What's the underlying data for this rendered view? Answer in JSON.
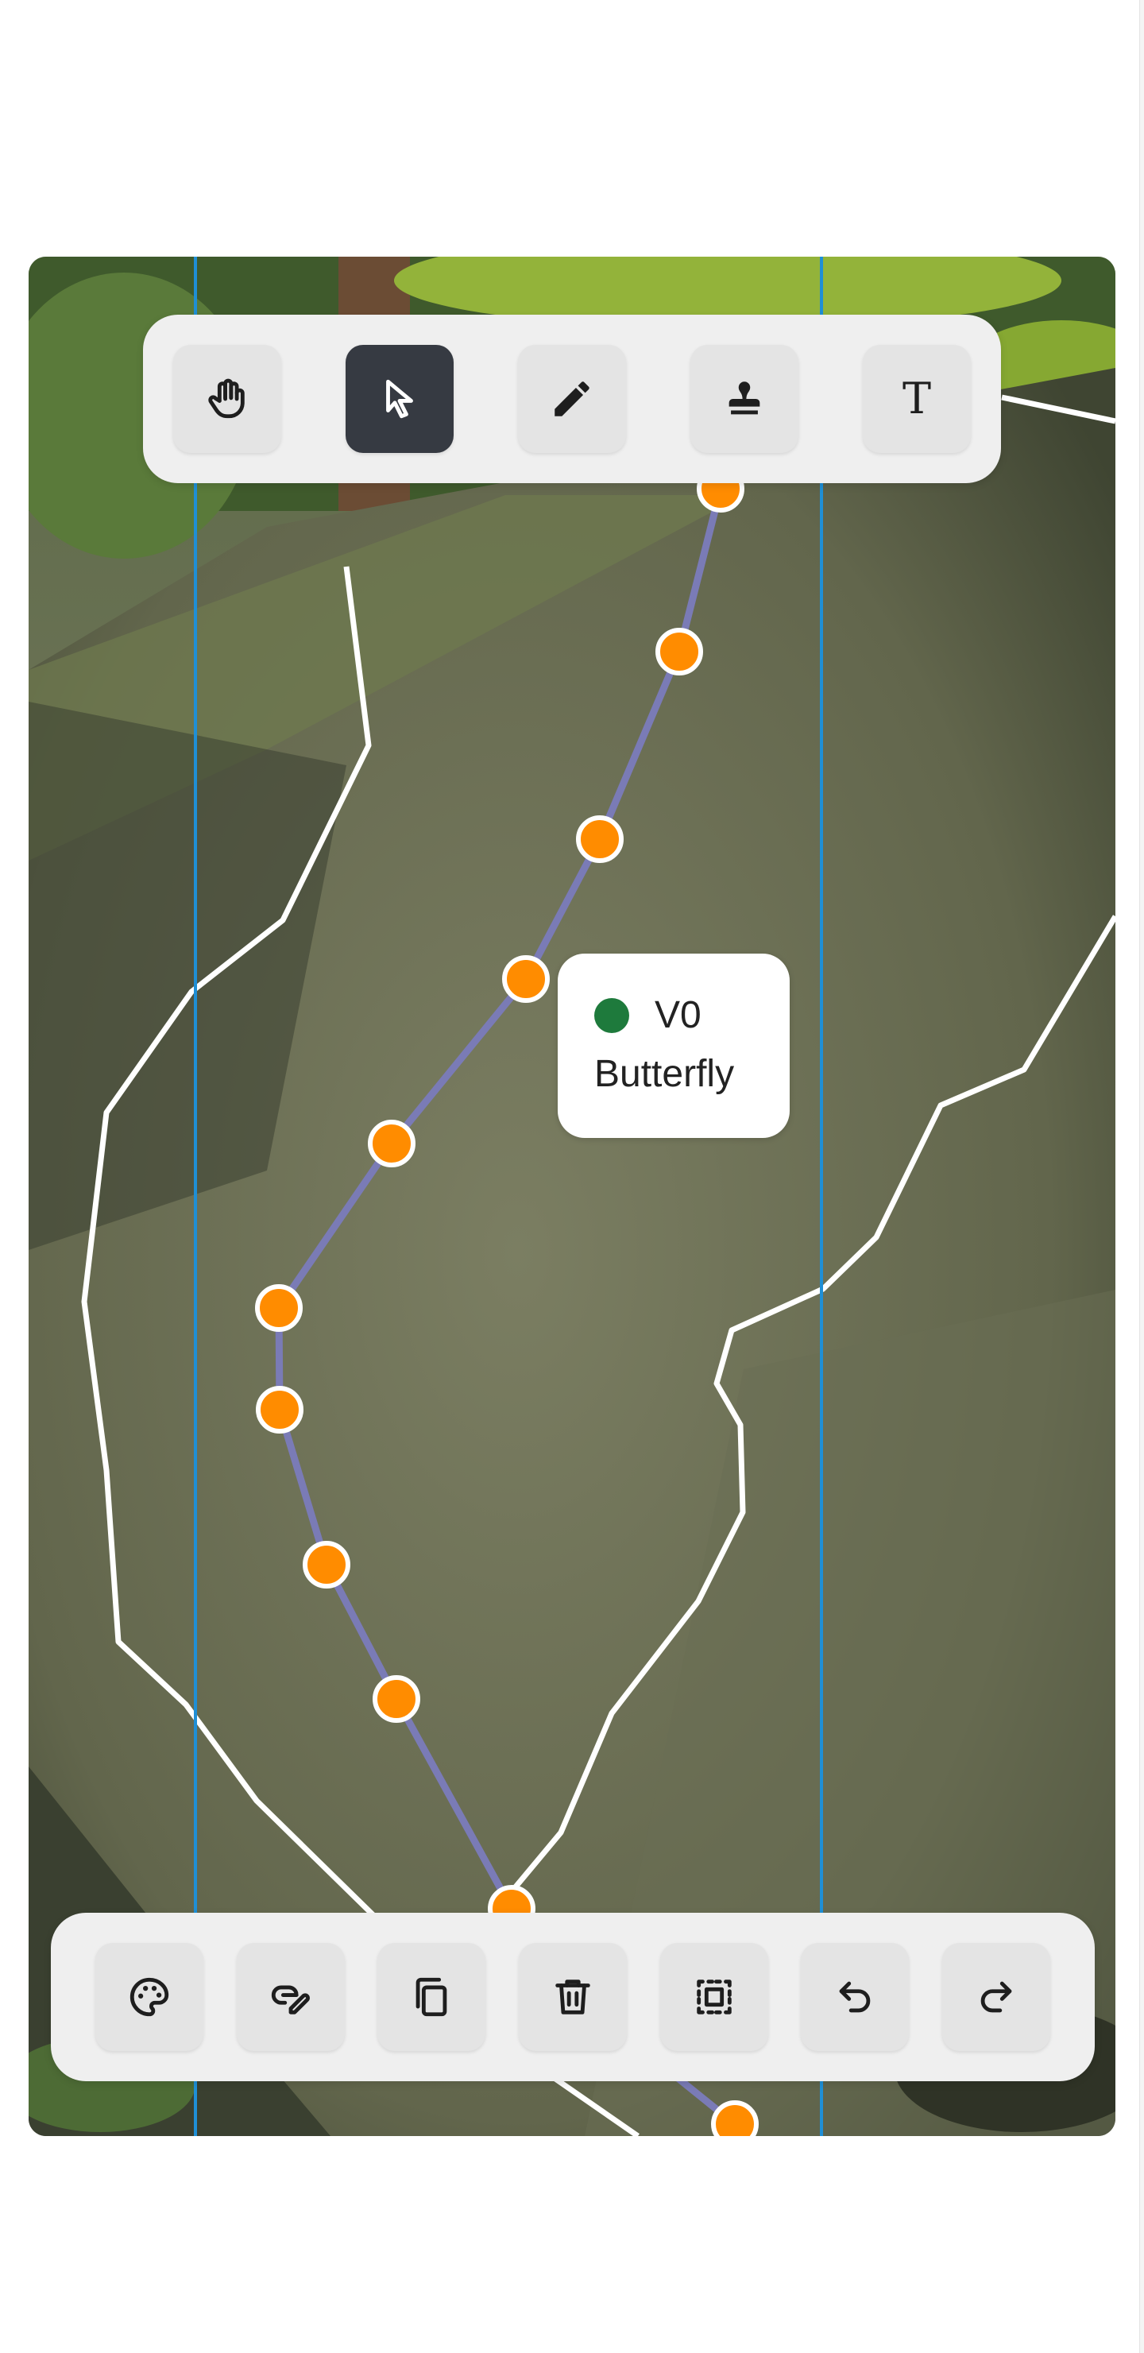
{
  "route_label": {
    "grade": "V0",
    "name": "Butterfly",
    "grade_color": "#1e7a3c"
  },
  "colors": {
    "route_line": "#7a7bb6",
    "hold_fill": "#ff8c00",
    "hold_stroke": "#ffffff",
    "boulder_outline": "#ffffff",
    "guide_line": "#1f8fd6",
    "active_tool_bg": "#363a42"
  },
  "top_toolbar": [
    {
      "name": "pan",
      "icon": "hand-icon",
      "active": false
    },
    {
      "name": "select",
      "icon": "cursor-arrow-icon",
      "active": true
    },
    {
      "name": "draw",
      "icon": "pencil-icon",
      "active": false
    },
    {
      "name": "stamp",
      "icon": "stamp-icon",
      "active": false
    },
    {
      "name": "text",
      "icon": "text-icon",
      "glyph": "T",
      "active": false
    }
  ],
  "bottom_toolbar": [
    {
      "name": "color",
      "icon": "palette-icon"
    },
    {
      "name": "edit-link",
      "icon": "link-edit-icon"
    },
    {
      "name": "duplicate",
      "icon": "copy-icon"
    },
    {
      "name": "delete",
      "icon": "trash-icon"
    },
    {
      "name": "select-all",
      "icon": "select-all-icon"
    },
    {
      "name": "undo",
      "icon": "undo-icon"
    },
    {
      "name": "redo",
      "icon": "redo-icon"
    }
  ]
}
